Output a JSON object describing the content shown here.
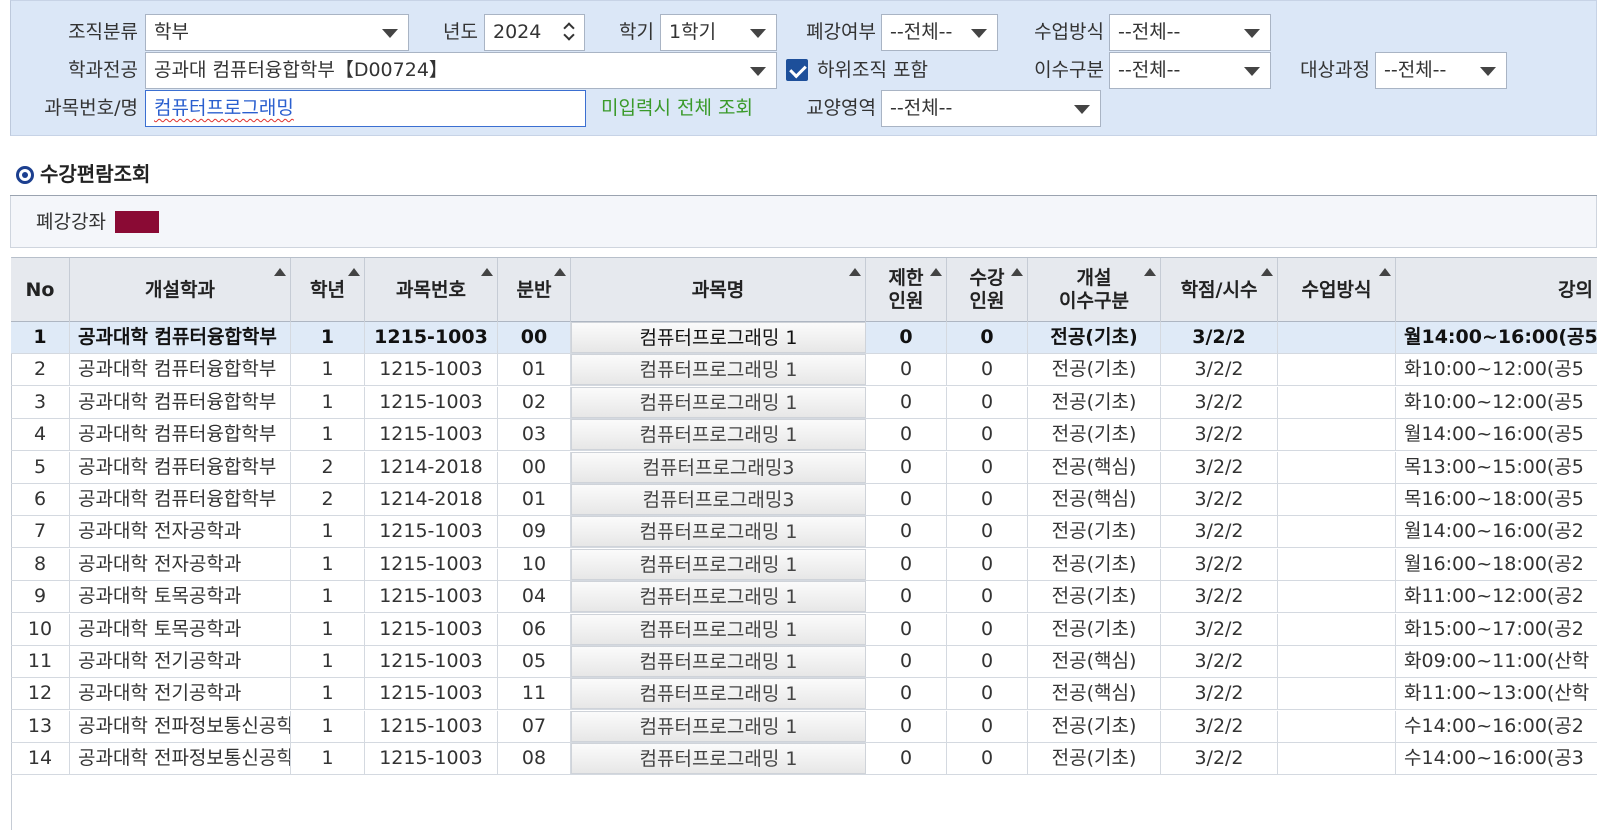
{
  "search": {
    "org_class_label": "조직분류",
    "org_class_value": "학부",
    "year_label": "년도",
    "year_value": "2024",
    "semester_label": "학기",
    "semester_value": "1학기",
    "closed_label": "폐강여부",
    "closed_value": "--전체--",
    "class_method_label": "수업방식",
    "class_method_value": "--전체--",
    "dept_label": "학과전공",
    "dept_value": "공과대 컴퓨터융합학부【D00724】",
    "include_sub_label": "하위조직 포함",
    "include_sub_checked": true,
    "completion_label": "이수구분",
    "completion_value": "--전체--",
    "target_label": "대상과정",
    "target_value": "--전체--",
    "course_label": "과목번호/명",
    "course_value": "컴퓨터프로그래밍",
    "hint": "미입력시 전체 조회",
    "liberal_label": "교양영역",
    "liberal_value": "--전체--"
  },
  "section": {
    "title": "수강편람조회",
    "legend_label": "폐강강좌",
    "legend_color": "#8a0a34"
  },
  "table": {
    "headers": {
      "no": "No",
      "dept": "개설학과",
      "grade": "학년",
      "code": "과목번호",
      "section": "분반",
      "name": "과목명",
      "limit1": "제한",
      "limit2": "인원",
      "enrolled1": "수강",
      "enrolled2": "인원",
      "open1": "개설",
      "open2": "이수구분",
      "credit": "학점/시수",
      "method": "수업방식",
      "lecture": "강의"
    },
    "rows": [
      {
        "no": "1",
        "dept": "공과대학 컴퓨터융합학부",
        "grade": "1",
        "code": "1215-1003",
        "section": "00",
        "name": "컴퓨터프로그래밍 1",
        "limit": "0",
        "enrolled": "0",
        "type": "전공(기초)",
        "credit": "3/2/2",
        "method": "",
        "time": "월14:00~16:00(공5"
      },
      {
        "no": "2",
        "dept": "공과대학 컴퓨터융합학부",
        "grade": "1",
        "code": "1215-1003",
        "section": "01",
        "name": "컴퓨터프로그래밍 1",
        "limit": "0",
        "enrolled": "0",
        "type": "전공(기초)",
        "credit": "3/2/2",
        "method": "",
        "time": "화10:00~12:00(공5"
      },
      {
        "no": "3",
        "dept": "공과대학 컴퓨터융합학부",
        "grade": "1",
        "code": "1215-1003",
        "section": "02",
        "name": "컴퓨터프로그래밍 1",
        "limit": "0",
        "enrolled": "0",
        "type": "전공(기초)",
        "credit": "3/2/2",
        "method": "",
        "time": "화10:00~12:00(공5"
      },
      {
        "no": "4",
        "dept": "공과대학 컴퓨터융합학부",
        "grade": "1",
        "code": "1215-1003",
        "section": "03",
        "name": "컴퓨터프로그래밍 1",
        "limit": "0",
        "enrolled": "0",
        "type": "전공(기초)",
        "credit": "3/2/2",
        "method": "",
        "time": "월14:00~16:00(공5"
      },
      {
        "no": "5",
        "dept": "공과대학 컴퓨터융합학부",
        "grade": "2",
        "code": "1214-2018",
        "section": "00",
        "name": "컴퓨터프로그래밍3",
        "limit": "0",
        "enrolled": "0",
        "type": "전공(핵심)",
        "credit": "3/2/2",
        "method": "",
        "time": "목13:00~15:00(공5"
      },
      {
        "no": "6",
        "dept": "공과대학 컴퓨터융합학부",
        "grade": "2",
        "code": "1214-2018",
        "section": "01",
        "name": "컴퓨터프로그래밍3",
        "limit": "0",
        "enrolled": "0",
        "type": "전공(핵심)",
        "credit": "3/2/2",
        "method": "",
        "time": "목16:00~18:00(공5"
      },
      {
        "no": "7",
        "dept": "공과대학 전자공학과",
        "grade": "1",
        "code": "1215-1003",
        "section": "09",
        "name": "컴퓨터프로그래밍 1",
        "limit": "0",
        "enrolled": "0",
        "type": "전공(기초)",
        "credit": "3/2/2",
        "method": "",
        "time": "월14:00~16:00(공2"
      },
      {
        "no": "8",
        "dept": "공과대학 전자공학과",
        "grade": "1",
        "code": "1215-1003",
        "section": "10",
        "name": "컴퓨터프로그래밍 1",
        "limit": "0",
        "enrolled": "0",
        "type": "전공(기초)",
        "credit": "3/2/2",
        "method": "",
        "time": "월16:00~18:00(공2"
      },
      {
        "no": "9",
        "dept": "공과대학 토목공학과",
        "grade": "1",
        "code": "1215-1003",
        "section": "04",
        "name": "컴퓨터프로그래밍 1",
        "limit": "0",
        "enrolled": "0",
        "type": "전공(기초)",
        "credit": "3/2/2",
        "method": "",
        "time": "화11:00~12:00(공2"
      },
      {
        "no": "10",
        "dept": "공과대학 토목공학과",
        "grade": "1",
        "code": "1215-1003",
        "section": "06",
        "name": "컴퓨터프로그래밍 1",
        "limit": "0",
        "enrolled": "0",
        "type": "전공(기초)",
        "credit": "3/2/2",
        "method": "",
        "time": "화15:00~17:00(공2"
      },
      {
        "no": "11",
        "dept": "공과대학 전기공학과",
        "grade": "1",
        "code": "1215-1003",
        "section": "05",
        "name": "컴퓨터프로그래밍 1",
        "limit": "0",
        "enrolled": "0",
        "type": "전공(핵심)",
        "credit": "3/2/2",
        "method": "",
        "time": "화09:00~11:00(산학"
      },
      {
        "no": "12",
        "dept": "공과대학 전기공학과",
        "grade": "1",
        "code": "1215-1003",
        "section": "11",
        "name": "컴퓨터프로그래밍 1",
        "limit": "0",
        "enrolled": "0",
        "type": "전공(핵심)",
        "credit": "3/2/2",
        "method": "",
        "time": "화11:00~13:00(산학"
      },
      {
        "no": "13",
        "dept": "공과대학 전파정보통신공학",
        "grade": "1",
        "code": "1215-1003",
        "section": "07",
        "name": "컴퓨터프로그래밍 1",
        "limit": "0",
        "enrolled": "0",
        "type": "전공(기초)",
        "credit": "3/2/2",
        "method": "",
        "time": "수14:00~16:00(공2"
      },
      {
        "no": "14",
        "dept": "공과대학 전파정보통신공학",
        "grade": "1",
        "code": "1215-1003",
        "section": "08",
        "name": "컴퓨터프로그래밍 1",
        "limit": "0",
        "enrolled": "0",
        "type": "전공(기초)",
        "credit": "3/2/2",
        "method": "",
        "time": "수14:00~16:00(공3"
      }
    ]
  }
}
